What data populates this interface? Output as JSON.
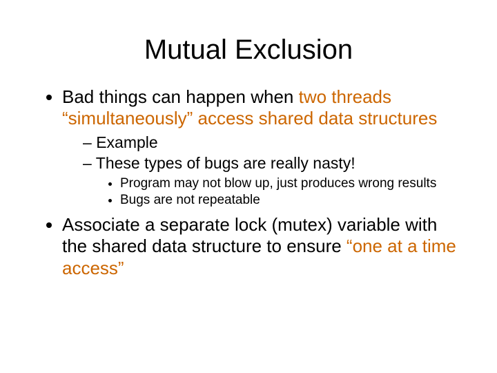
{
  "slide": {
    "title": "Mutual Exclusion",
    "b1_pre": "Bad things can happen when ",
    "b1_acc": "two threads “simultaneously” access shared data structures",
    "b1_sub1": "Example",
    "b1_sub2": "These types of bugs are really nasty!",
    "b1_sub2_i1": "Program may not blow up, just produces wrong results",
    "b1_sub2_i2": "Bugs are not repeatable",
    "b2_pre": "Associate a separate lock (mutex) variable with the shared data structure to ensure ",
    "b2_acc": "“one at a time access”"
  }
}
